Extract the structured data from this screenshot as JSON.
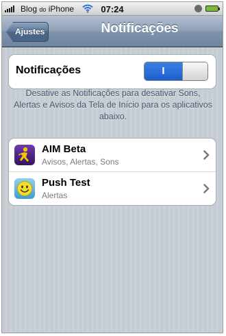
{
  "status_bar": {
    "carrier": "Blog",
    "carrier_small": "do",
    "carrier_suffix": "iPhone",
    "time": "07:24"
  },
  "nav": {
    "back_label": "Ajustes",
    "title": "Notificações"
  },
  "notifications_toggle": {
    "label": "Notificações",
    "state_label": "I",
    "on": true
  },
  "footnote": "Desative as Notificações para desativar Sons, Alertas e Avisos da Tela de Início para os aplicativos abaixo.",
  "apps": [
    {
      "name": "AIM Beta",
      "subtitle": "Avisos, Alertas, Sons",
      "icon": "aim-icon"
    },
    {
      "name": "Push Test",
      "subtitle": "Alertas",
      "icon": "smiley-icon"
    }
  ],
  "colors": {
    "nav_bar": "#7f93ab",
    "toggle_on": "#2a6fdb",
    "background": "#c5ccd4"
  }
}
